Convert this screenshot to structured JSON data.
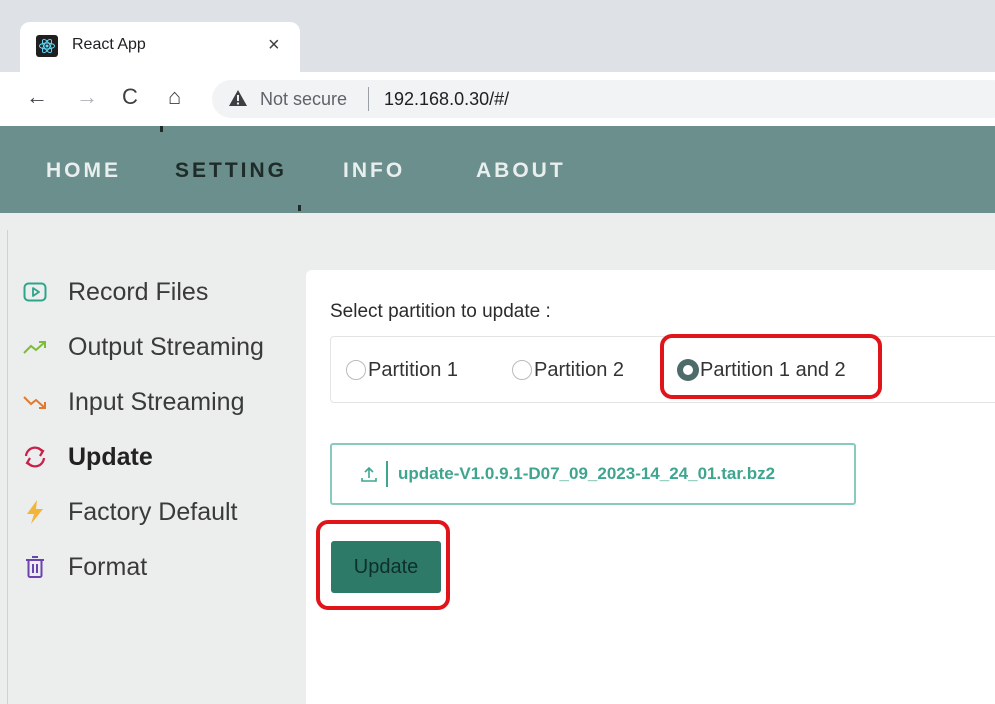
{
  "browser": {
    "tab_title": "React App",
    "close_glyph": "×",
    "back_glyph": "←",
    "forward_glyph": "→",
    "reload_glyph": "C",
    "home_glyph": "⌂",
    "security_label": "Not secure",
    "url": "192.168.0.30/#/"
  },
  "nav": {
    "items": [
      {
        "label": "HOME"
      },
      {
        "label": "SETTING"
      },
      {
        "label": "INFO"
      },
      {
        "label": "ABOUT"
      }
    ],
    "active": "SETTING",
    "bar_color": "#6b8f8c"
  },
  "sidebar": {
    "items": [
      {
        "label": "Record Files",
        "icon": "play-icon"
      },
      {
        "label": "Output Streaming",
        "icon": "trend-up-icon"
      },
      {
        "label": "Input Streaming",
        "icon": "trend-down-icon"
      },
      {
        "label": "Update",
        "icon": "sync-icon",
        "active": true
      },
      {
        "label": "Factory Default",
        "icon": "lightning-icon"
      },
      {
        "label": "Format",
        "icon": "trash-icon"
      }
    ]
  },
  "update": {
    "heading": "Select partition to update :",
    "options": [
      {
        "label": "Partition 1",
        "checked": false
      },
      {
        "label": "Partition 2",
        "checked": false
      },
      {
        "label": "Partition 1 and 2",
        "checked": true
      }
    ],
    "file_name": "update-V1.0.9.1-D07_09_2023-14_24_01.tar.bz2",
    "button_label": "Update",
    "accent": "#2d7a69"
  }
}
